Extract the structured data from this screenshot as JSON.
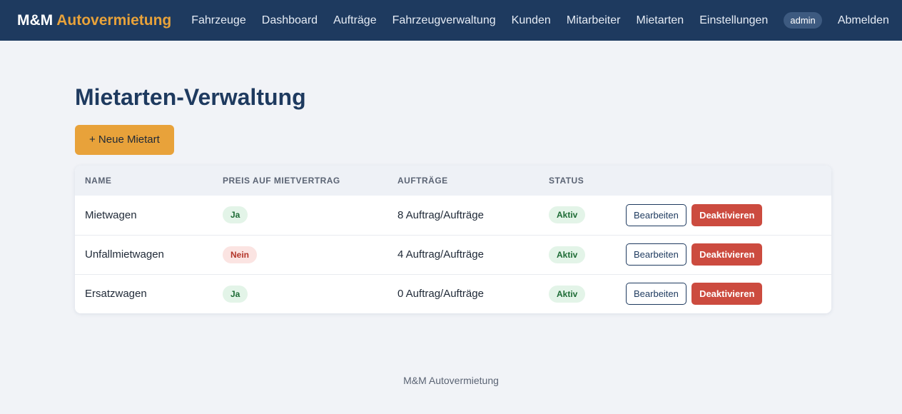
{
  "brand": {
    "primary": "M&M",
    "accent": "Autovermietung"
  },
  "nav": {
    "links": [
      "Fahrzeuge",
      "Dashboard",
      "Aufträge",
      "Fahrzeugverwaltung",
      "Kunden",
      "Mitarbeiter",
      "Mietarten",
      "Einstellungen"
    ],
    "user": "admin",
    "logout": "Abmelden"
  },
  "page": {
    "title": "Mietarten-Verwaltung",
    "new_button": "+ Neue Mietart"
  },
  "table": {
    "headers": [
      "NAME",
      "PREIS AUF MIETVERTRAG",
      "AUFTRÄGE",
      "STATUS",
      ""
    ],
    "rows": [
      {
        "name": "Mietwagen",
        "price": "Ja",
        "orders": "8 Auftrag/Aufträge",
        "status": "Aktiv",
        "edit": "Bearbeiten",
        "deactivate": "Deaktivieren"
      },
      {
        "name": "Unfallmietwagen",
        "price": "Nein",
        "orders": "4 Auftrag/Aufträge",
        "status": "Aktiv",
        "edit": "Bearbeiten",
        "deactivate": "Deaktivieren"
      },
      {
        "name": "Ersatzwagen",
        "price": "Ja",
        "orders": "0 Auftrag/Aufträge",
        "status": "Aktiv",
        "edit": "Bearbeiten",
        "deactivate": "Deaktivieren"
      }
    ]
  },
  "footer": {
    "text": "M&M Autovermietung"
  },
  "colors": {
    "navbar": "#1e3a5f",
    "accent": "#e8a23a",
    "danger": "#cc4b3f",
    "success_bg": "#e3f4e8",
    "danger_bg": "#fbe4e2",
    "background": "#f1f3f7"
  }
}
